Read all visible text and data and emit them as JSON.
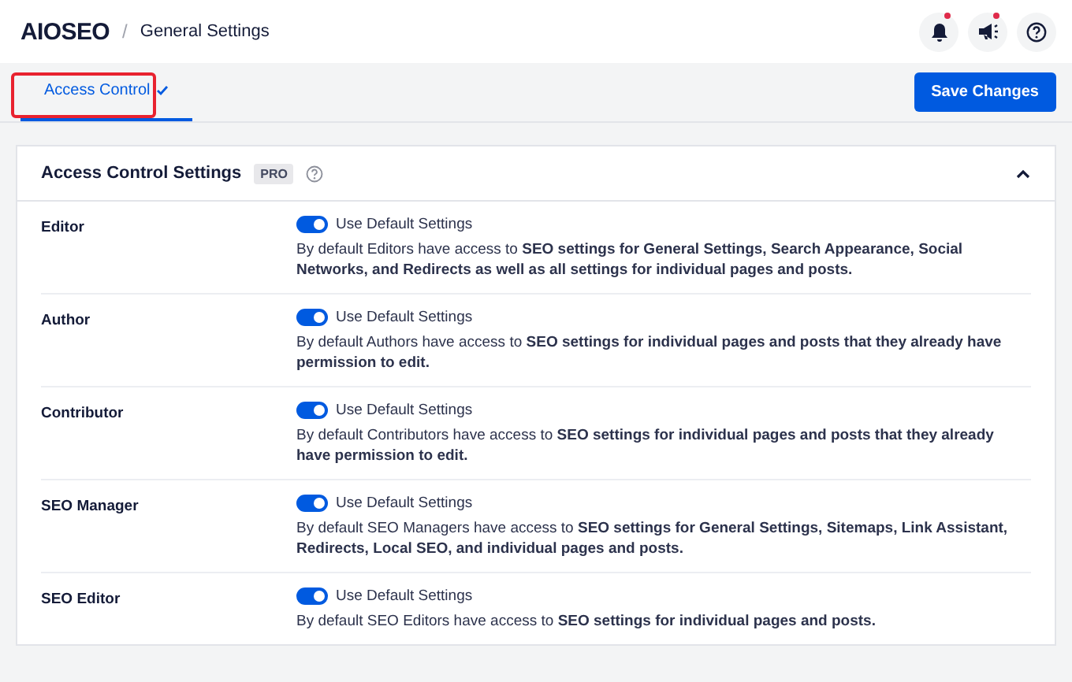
{
  "header": {
    "logo": "AIOSEO",
    "separator": "/",
    "title": "General Settings",
    "notifications": [
      {
        "kind": "bell",
        "unread": true
      },
      {
        "kind": "megaphone",
        "unread": true
      },
      {
        "kind": "help",
        "unread": false
      }
    ]
  },
  "tabs": [
    {
      "label": "Access Control",
      "selected": true,
      "highlighted": true
    }
  ],
  "save_button": "Save Changes",
  "card": {
    "title": "Access Control Settings",
    "badge": "PRO",
    "expanded": true,
    "rows": [
      {
        "role": "Editor",
        "toggle_label": "Use Default Settings",
        "on": true,
        "description": "By default Editors have access to **SEO settings for General Settings, Search Appearance, Social Networks, and Redirects as well as all settings for individual pages and posts.**"
      },
      {
        "role": "Author",
        "toggle_label": "Use Default Settings",
        "on": true,
        "description": "By default Authors have access to **SEO settings for individual pages and posts that they already have permission to edit.**"
      },
      {
        "role": "Contributor",
        "toggle_label": "Use Default Settings",
        "on": true,
        "description": "By default Contributors have access to **SEO settings for individual pages and posts that they already have permission to edit.**"
      },
      {
        "role": "SEO Manager",
        "toggle_label": "Use Default Settings",
        "on": true,
        "description": "By default SEO Managers have access to **SEO settings for General Settings, Sitemaps, Link Assistant, Redirects, Local SEO, and individual pages and posts.**"
      },
      {
        "role": "SEO Editor",
        "toggle_label": "Use Default Settings",
        "on": true,
        "description": "By default SEO Editors have access to **SEO settings for individual pages and posts.**"
      }
    ]
  }
}
